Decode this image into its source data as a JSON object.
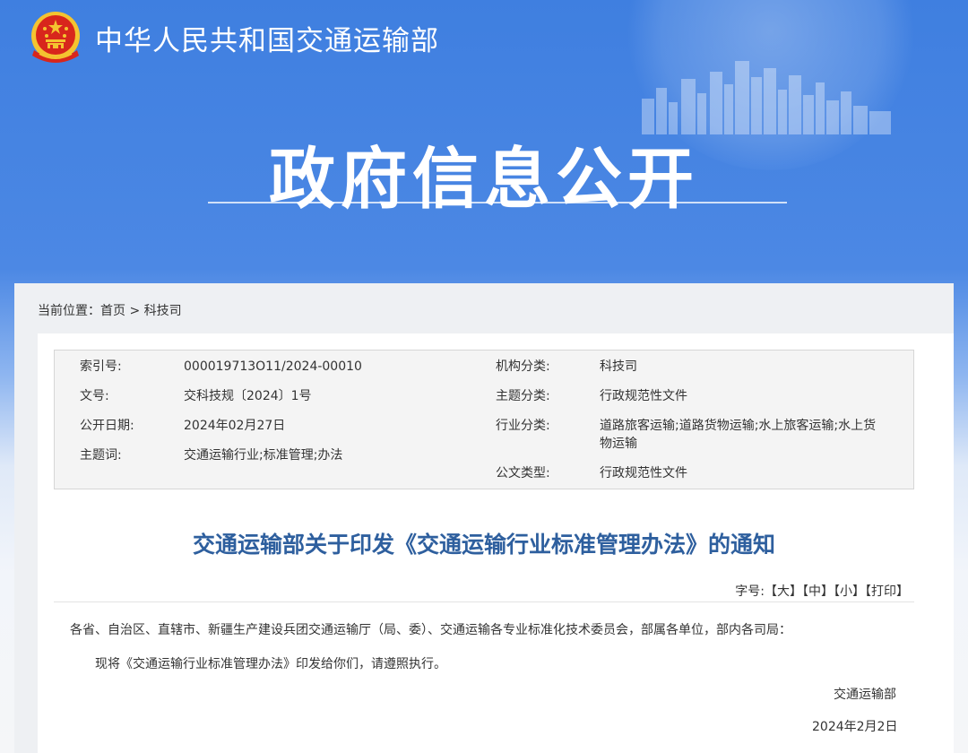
{
  "header": {
    "site_name": "中华人民共和国交通运输部",
    "hero_title": "政府信息公开"
  },
  "breadcrumb": {
    "prefix": "当前位置：",
    "home": "首页",
    "separator": " > ",
    "current": "科技司"
  },
  "meta": {
    "index_label": "索引号:",
    "index_value": "000019713O11/2024-00010",
    "org_label": "机构分类:",
    "org_value": "科技司",
    "docno_label": "文号:",
    "docno_value": "交科技规〔2024〕1号",
    "topic_label": "主题分类:",
    "topic_value": "行政规范性文件",
    "date_label": "公开日期:",
    "date_value": "2024年02月27日",
    "industry_label": "行业分类:",
    "industry_value": "道路旅客运输;道路货物运输;水上旅客运输;水上货物运输",
    "keywords_label": "主题词:",
    "keywords_value": "交通运输行业;标准管理;办法",
    "doctype_label": "公文类型:",
    "doctype_value": "行政规范性文件"
  },
  "article": {
    "title": "交通运输部关于印发《交通运输行业标准管理办法》的通知",
    "fontsize_label": "字号:",
    "font_large": "【大】",
    "font_medium": "【中】",
    "font_small": "【小】",
    "print": "【打印】",
    "recipients": "各省、自治区、直辖市、新疆生产建设兵团交通运输厅（局、委）、交通运输各专业标准化技术委员会，部属各单位，部内各司局：",
    "body": "现将《交通运输行业标准管理办法》印发给你们，请遵照执行。",
    "signature": "交通运输部",
    "sign_date": "2024年2月2日"
  },
  "colors": {
    "banner_blue": "#4c88e4",
    "title_blue": "#2e5f9e",
    "emblem_red": "#d8261c",
    "emblem_gold": "#f4c430"
  }
}
